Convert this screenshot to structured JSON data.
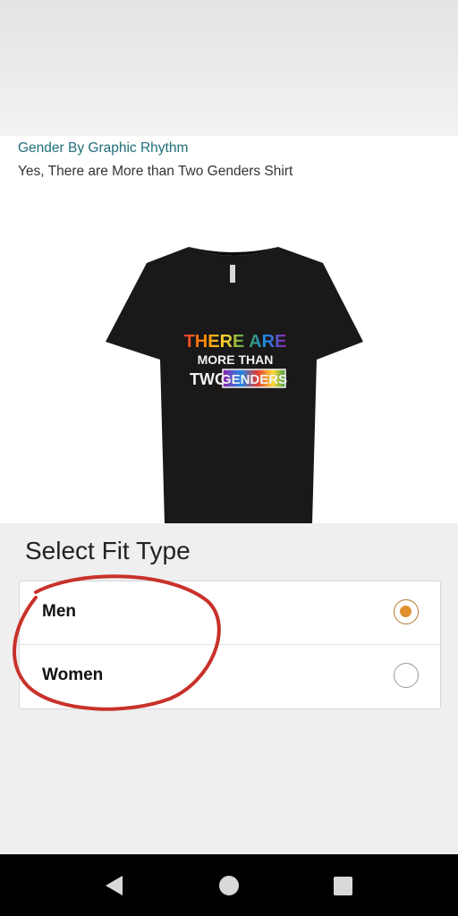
{
  "product": {
    "brand": "Gender By Graphic Rhythm",
    "title": "Yes, There are More than Two Genders Shirt",
    "shirt_print": {
      "line1": "THERE ARE",
      "line2": "MORE THAN",
      "line3a": "TWO",
      "line3b": "GENDERS"
    }
  },
  "fit": {
    "heading": "Select Fit Type",
    "options": [
      {
        "label": "Men",
        "selected": true
      },
      {
        "label": "Women",
        "selected": false
      }
    ]
  },
  "colors": {
    "brand_link": "#1f6f7a",
    "radio_selected": "#e0902e",
    "annotation_circle": "#c8312a"
  },
  "navbar": {
    "icons": [
      "back-icon",
      "home-icon",
      "recents-icon"
    ]
  }
}
